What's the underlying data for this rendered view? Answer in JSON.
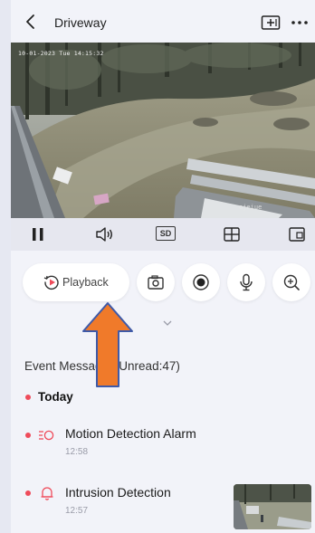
{
  "header": {
    "title": "Driveway",
    "back_icon": "chevron-left-icon",
    "add_view_icon": "add-view-icon",
    "more_icon": "more-icon"
  },
  "video": {
    "timestamp": "10-01-2023 Tue 14:15:32",
    "watermark": "ejeiue"
  },
  "controls": {
    "pause_icon": "pause-icon",
    "sound_icon": "speaker-icon",
    "quality_label": "SD",
    "layout_icon": "grid-icon",
    "switch_icon": "switch-window-icon"
  },
  "actions": {
    "playback_label": "Playback",
    "buttons": [
      "playback-icon",
      "snapshot-icon",
      "record-icon",
      "microphone-icon",
      "zoom-in-icon"
    ]
  },
  "events": {
    "header": "Event Messages(Unread:47)",
    "group_label": "Today",
    "items": [
      {
        "title": "Motion Detection Alarm",
        "time": "12:58",
        "icon": "motion-icon"
      },
      {
        "title": "Intrusion Detection",
        "time": "12:57",
        "icon": "bell-icon"
      }
    ]
  },
  "colors": {
    "accent": "#ef4b5a",
    "background": "#f2f3f9",
    "annotation_arrow": "#f07a2a",
    "annotation_border": "#3f5aa8"
  }
}
